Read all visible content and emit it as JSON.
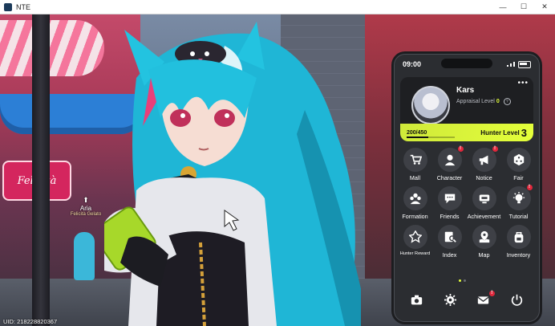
{
  "window": {
    "title": "NTE",
    "controls": [
      "—",
      "☐",
      "✕"
    ]
  },
  "scene": {
    "shop_sign": "Felicità",
    "npc": {
      "name": "Aria",
      "subtitle": "Felicità Gelato"
    }
  },
  "phone": {
    "time": "09:00",
    "profile": {
      "name": "Kars",
      "appraisal_label": "Appraisal Level",
      "appraisal_value": "0",
      "info_glyph": "?",
      "more_glyph": "•••",
      "exp_text": "200/450",
      "exp_fraction": 0.444,
      "hunter_level_label": "Hunter Level",
      "hunter_level_value": "3"
    },
    "apps": [
      {
        "label": "Mall",
        "icon": "cart-icon",
        "badge": false
      },
      {
        "label": "Character",
        "icon": "character-icon",
        "badge": true
      },
      {
        "label": "Notice",
        "icon": "megaphone-icon",
        "badge": true
      },
      {
        "label": "Fair",
        "icon": "dice-icon",
        "badge": false
      },
      {
        "label": "Formation",
        "icon": "formation-icon",
        "badge": false
      },
      {
        "label": "Friends",
        "icon": "chat-bubble-icon",
        "badge": false
      },
      {
        "label": "Achievement",
        "icon": "trophy-icon",
        "badge": false
      },
      {
        "label": "Tutorial",
        "icon": "bulb-icon",
        "badge": true
      },
      {
        "label": "Hunter Reward",
        "icon": "reward-icon",
        "badge": false
      },
      {
        "label": "Index",
        "icon": "index-icon",
        "badge": false
      },
      {
        "label": "Map",
        "icon": "map-icon",
        "badge": false
      },
      {
        "label": "Inventory",
        "icon": "backpack-icon",
        "badge": false
      }
    ],
    "badge_glyph": "!",
    "dock": [
      {
        "name": "camera",
        "icon": "camera-icon",
        "badge": false
      },
      {
        "name": "settings",
        "icon": "gear-icon",
        "badge": false
      },
      {
        "name": "mail",
        "icon": "mail-icon",
        "badge": true
      },
      {
        "name": "power",
        "icon": "power-icon",
        "badge": false
      }
    ],
    "accent_color": "#e4ff3a",
    "badge_color": "#e0283c"
  },
  "uid_text": "UID: 218228820367"
}
